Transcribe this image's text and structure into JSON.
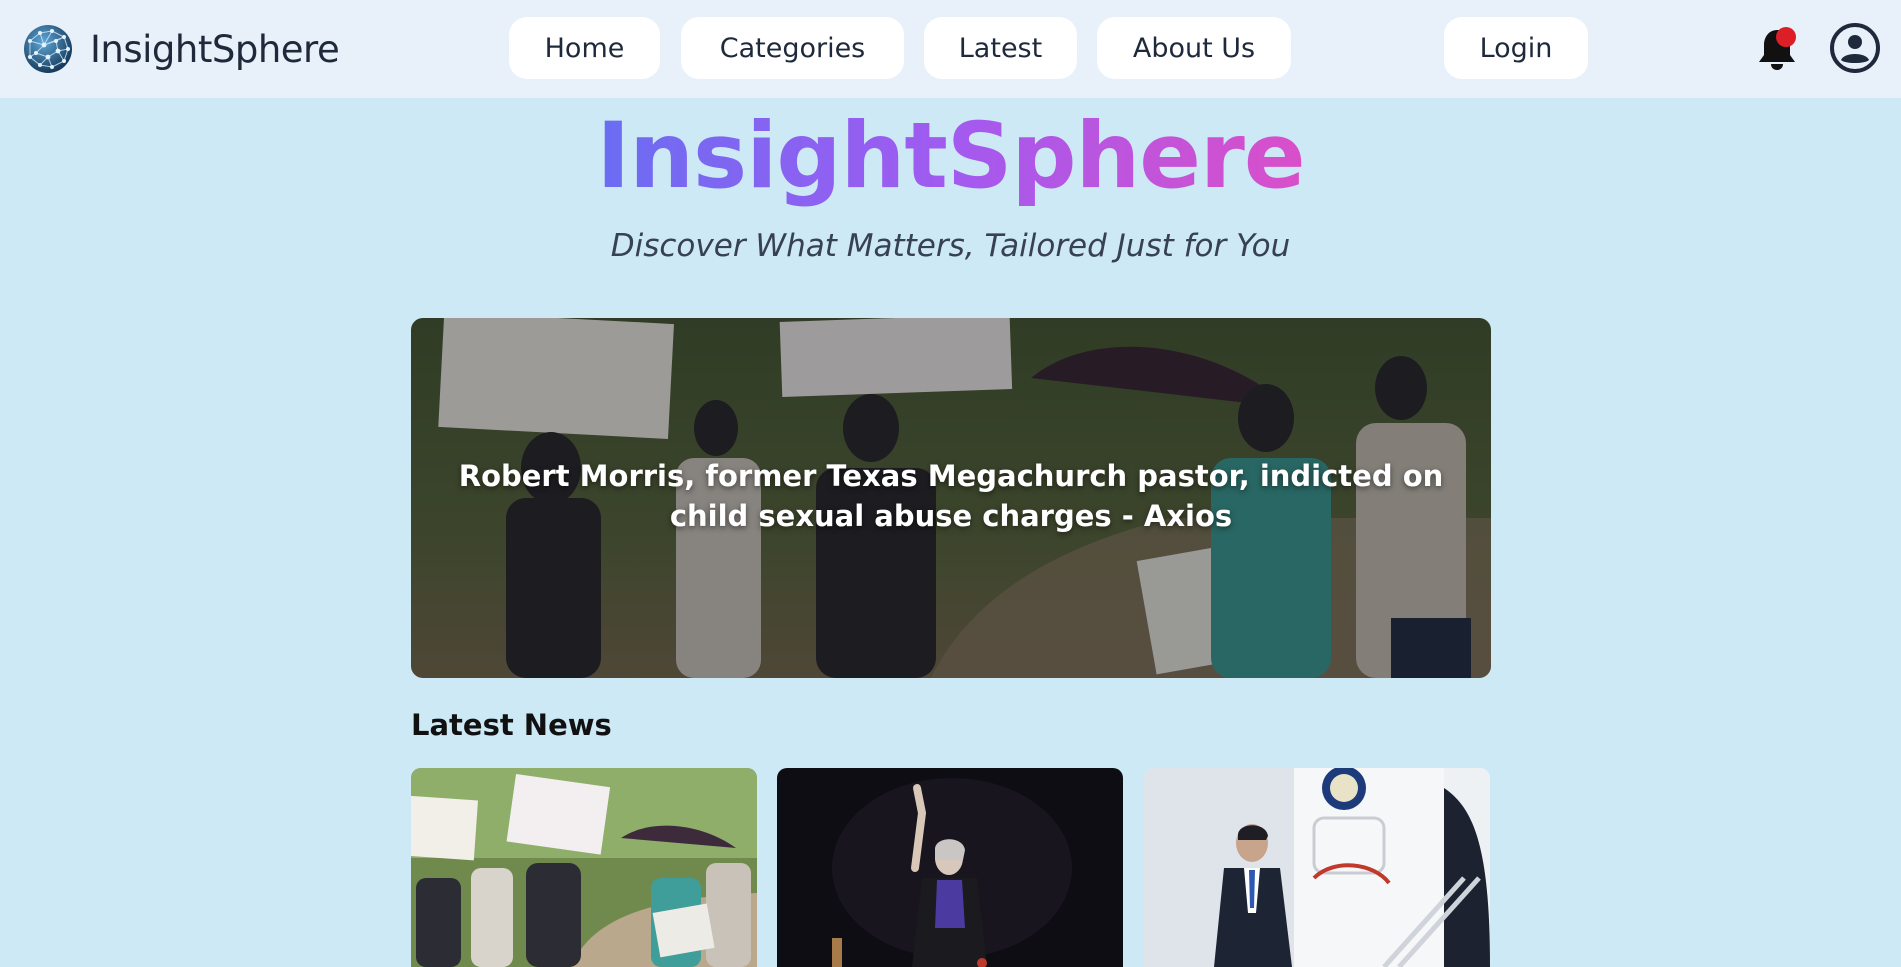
{
  "brand": {
    "name": "InsightSphere",
    "logo_icon": "globe-network-icon"
  },
  "nav": {
    "items": [
      {
        "label": "Home"
      },
      {
        "label": "Categories"
      },
      {
        "label": "Latest"
      },
      {
        "label": "About Us"
      }
    ],
    "login_label": "Login",
    "notification_icon": "bell-icon",
    "profile_icon": "user-circle-icon"
  },
  "hero": {
    "title": "InsightSphere",
    "tagline": "Discover What Matters, Tailored Just for You"
  },
  "featured": {
    "headline": "Robert Morris, former Texas Megachurch pastor, indicted on child sexual abuse charges - Axios"
  },
  "latest": {
    "heading": "Latest News"
  },
  "colors": {
    "page_bg": "#cde9f5",
    "nav_bg": "#e8f0f9",
    "gradient_start": "#6a6df2",
    "gradient_end": "#da4fc9",
    "notification_dot": "#dc1f26"
  }
}
